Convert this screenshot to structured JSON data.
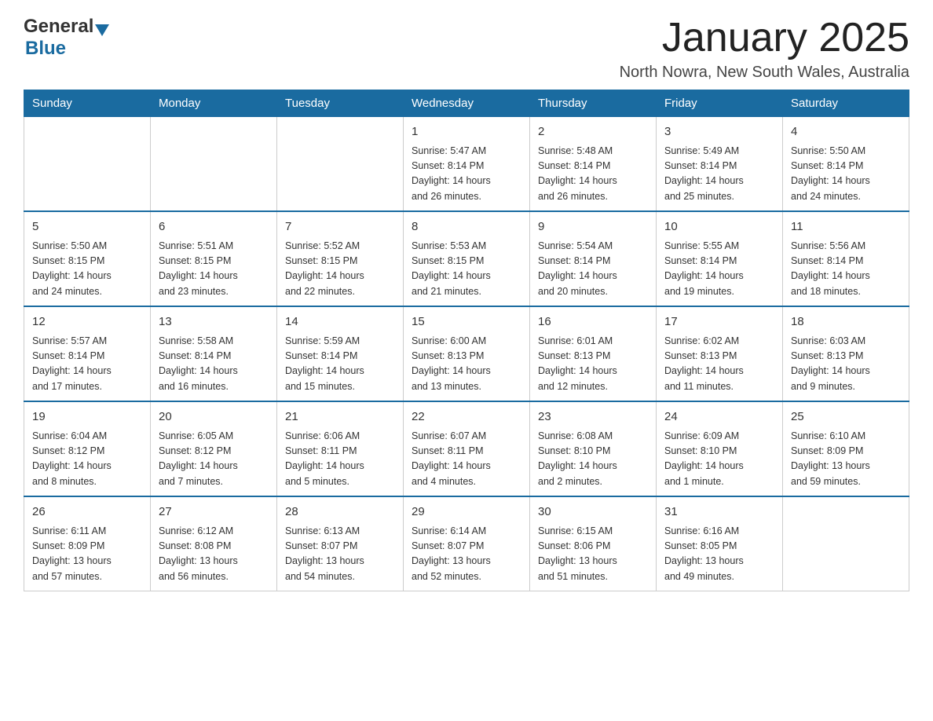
{
  "header": {
    "logo_general": "General",
    "logo_blue": "Blue",
    "month_title": "January 2025",
    "location": "North Nowra, New South Wales, Australia"
  },
  "days_of_week": [
    "Sunday",
    "Monday",
    "Tuesday",
    "Wednesday",
    "Thursday",
    "Friday",
    "Saturday"
  ],
  "weeks": [
    [
      {
        "day": "",
        "info": ""
      },
      {
        "day": "",
        "info": ""
      },
      {
        "day": "",
        "info": ""
      },
      {
        "day": "1",
        "info": "Sunrise: 5:47 AM\nSunset: 8:14 PM\nDaylight: 14 hours\nand 26 minutes."
      },
      {
        "day": "2",
        "info": "Sunrise: 5:48 AM\nSunset: 8:14 PM\nDaylight: 14 hours\nand 26 minutes."
      },
      {
        "day": "3",
        "info": "Sunrise: 5:49 AM\nSunset: 8:14 PM\nDaylight: 14 hours\nand 25 minutes."
      },
      {
        "day": "4",
        "info": "Sunrise: 5:50 AM\nSunset: 8:14 PM\nDaylight: 14 hours\nand 24 minutes."
      }
    ],
    [
      {
        "day": "5",
        "info": "Sunrise: 5:50 AM\nSunset: 8:15 PM\nDaylight: 14 hours\nand 24 minutes."
      },
      {
        "day": "6",
        "info": "Sunrise: 5:51 AM\nSunset: 8:15 PM\nDaylight: 14 hours\nand 23 minutes."
      },
      {
        "day": "7",
        "info": "Sunrise: 5:52 AM\nSunset: 8:15 PM\nDaylight: 14 hours\nand 22 minutes."
      },
      {
        "day": "8",
        "info": "Sunrise: 5:53 AM\nSunset: 8:15 PM\nDaylight: 14 hours\nand 21 minutes."
      },
      {
        "day": "9",
        "info": "Sunrise: 5:54 AM\nSunset: 8:14 PM\nDaylight: 14 hours\nand 20 minutes."
      },
      {
        "day": "10",
        "info": "Sunrise: 5:55 AM\nSunset: 8:14 PM\nDaylight: 14 hours\nand 19 minutes."
      },
      {
        "day": "11",
        "info": "Sunrise: 5:56 AM\nSunset: 8:14 PM\nDaylight: 14 hours\nand 18 minutes."
      }
    ],
    [
      {
        "day": "12",
        "info": "Sunrise: 5:57 AM\nSunset: 8:14 PM\nDaylight: 14 hours\nand 17 minutes."
      },
      {
        "day": "13",
        "info": "Sunrise: 5:58 AM\nSunset: 8:14 PM\nDaylight: 14 hours\nand 16 minutes."
      },
      {
        "day": "14",
        "info": "Sunrise: 5:59 AM\nSunset: 8:14 PM\nDaylight: 14 hours\nand 15 minutes."
      },
      {
        "day": "15",
        "info": "Sunrise: 6:00 AM\nSunset: 8:13 PM\nDaylight: 14 hours\nand 13 minutes."
      },
      {
        "day": "16",
        "info": "Sunrise: 6:01 AM\nSunset: 8:13 PM\nDaylight: 14 hours\nand 12 minutes."
      },
      {
        "day": "17",
        "info": "Sunrise: 6:02 AM\nSunset: 8:13 PM\nDaylight: 14 hours\nand 11 minutes."
      },
      {
        "day": "18",
        "info": "Sunrise: 6:03 AM\nSunset: 8:13 PM\nDaylight: 14 hours\nand 9 minutes."
      }
    ],
    [
      {
        "day": "19",
        "info": "Sunrise: 6:04 AM\nSunset: 8:12 PM\nDaylight: 14 hours\nand 8 minutes."
      },
      {
        "day": "20",
        "info": "Sunrise: 6:05 AM\nSunset: 8:12 PM\nDaylight: 14 hours\nand 7 minutes."
      },
      {
        "day": "21",
        "info": "Sunrise: 6:06 AM\nSunset: 8:11 PM\nDaylight: 14 hours\nand 5 minutes."
      },
      {
        "day": "22",
        "info": "Sunrise: 6:07 AM\nSunset: 8:11 PM\nDaylight: 14 hours\nand 4 minutes."
      },
      {
        "day": "23",
        "info": "Sunrise: 6:08 AM\nSunset: 8:10 PM\nDaylight: 14 hours\nand 2 minutes."
      },
      {
        "day": "24",
        "info": "Sunrise: 6:09 AM\nSunset: 8:10 PM\nDaylight: 14 hours\nand 1 minute."
      },
      {
        "day": "25",
        "info": "Sunrise: 6:10 AM\nSunset: 8:09 PM\nDaylight: 13 hours\nand 59 minutes."
      }
    ],
    [
      {
        "day": "26",
        "info": "Sunrise: 6:11 AM\nSunset: 8:09 PM\nDaylight: 13 hours\nand 57 minutes."
      },
      {
        "day": "27",
        "info": "Sunrise: 6:12 AM\nSunset: 8:08 PM\nDaylight: 13 hours\nand 56 minutes."
      },
      {
        "day": "28",
        "info": "Sunrise: 6:13 AM\nSunset: 8:07 PM\nDaylight: 13 hours\nand 54 minutes."
      },
      {
        "day": "29",
        "info": "Sunrise: 6:14 AM\nSunset: 8:07 PM\nDaylight: 13 hours\nand 52 minutes."
      },
      {
        "day": "30",
        "info": "Sunrise: 6:15 AM\nSunset: 8:06 PM\nDaylight: 13 hours\nand 51 minutes."
      },
      {
        "day": "31",
        "info": "Sunrise: 6:16 AM\nSunset: 8:05 PM\nDaylight: 13 hours\nand 49 minutes."
      },
      {
        "day": "",
        "info": ""
      }
    ]
  ]
}
